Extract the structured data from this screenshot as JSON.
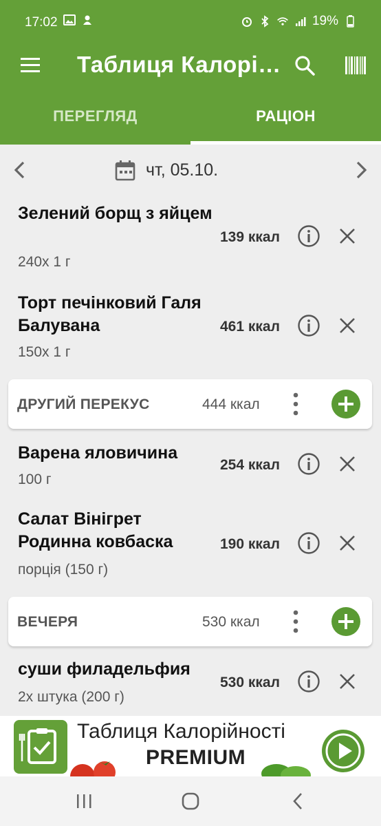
{
  "status": {
    "time": "17:02",
    "battery": "19%"
  },
  "appbar": {
    "title": "Таблиця Калорі…"
  },
  "tabs": [
    {
      "label": "ПЕРЕГЛЯД",
      "selected": false
    },
    {
      "label": "РАЦІОН",
      "selected": true
    }
  ],
  "datebar": {
    "date": "чт, 05.10."
  },
  "items": [
    {
      "name": "Зелений борщ з яйцем",
      "portion": "240x 1 г",
      "kcal": "139 ккал"
    },
    {
      "name": "Торт печінковий Галя Балувана",
      "portion": "150x 1 г",
      "kcal": "461 ккал"
    },
    {
      "name": "Варена яловичина",
      "portion": "100 г",
      "kcal": "254 ккал"
    },
    {
      "name": "Салат Вінігрет Родинна ковбаска",
      "portion": "порція (150 г)",
      "kcal": "190 ккал"
    },
    {
      "name": "суши филадельфия",
      "portion": "2x штука (200 г)",
      "kcal": "530 ккал"
    }
  ],
  "sections": [
    {
      "name": "ДРУГИЙ ПЕРЕКУС",
      "kcal": "444 ккал"
    },
    {
      "name": "ВЕЧЕРЯ",
      "kcal": "530 ккал"
    }
  ],
  "banner": {
    "line1": "Таблиця Калорійності",
    "line2": "PREMIUM"
  },
  "colors": {
    "primary": "#64a038",
    "accent": "#5a9a33",
    "background": "#eeeeee"
  }
}
